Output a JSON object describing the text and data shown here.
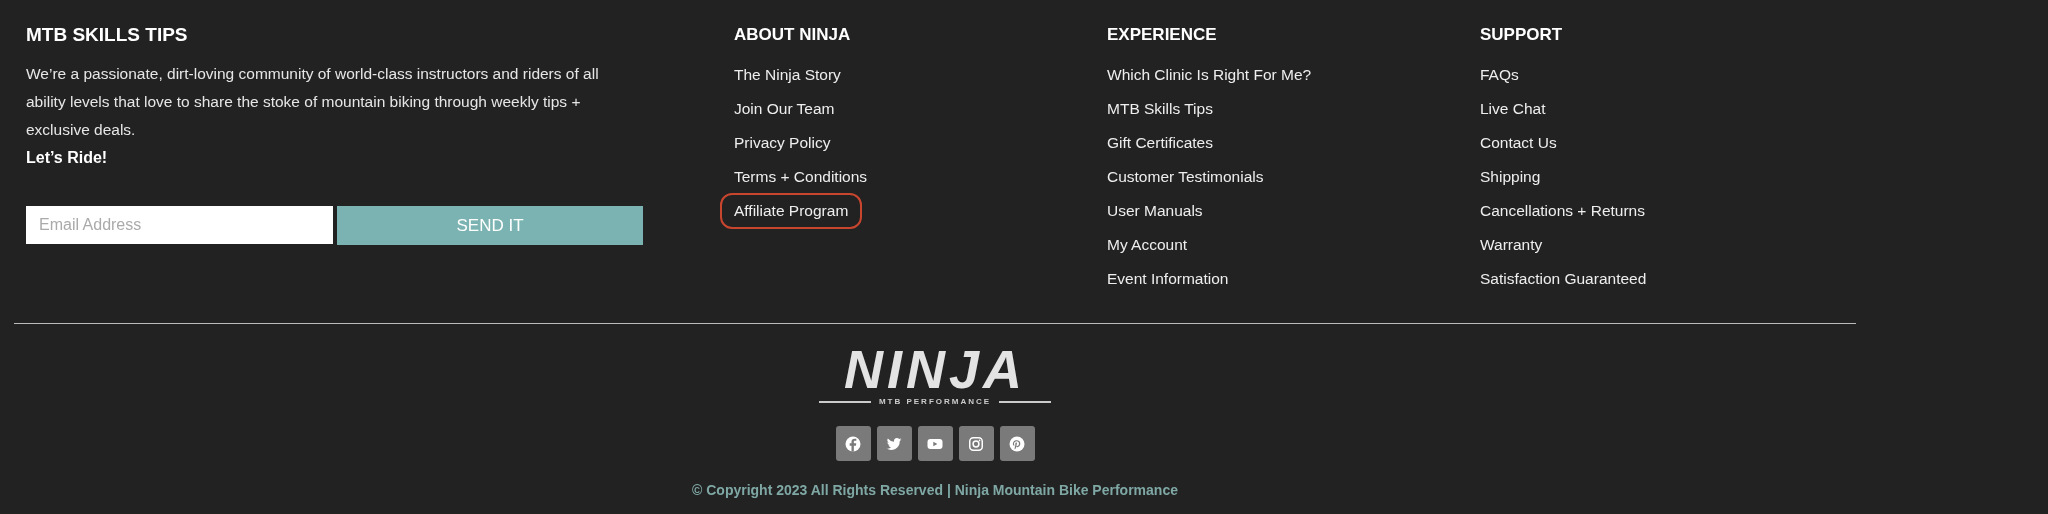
{
  "newsletter": {
    "heading": "MTB SKILLS TIPS",
    "text": "We’re a passionate, dirt-loving community of world-class instructors and riders of all ability levels that love to share the stoke of mountain biking through weekly tips + exclusive deals.",
    "tagline": "Let’s Ride!",
    "email_field": {
      "placeholder": "Email Address"
    },
    "button": "SEND IT"
  },
  "columns": [
    {
      "heading": "ABOUT NINJA",
      "links": [
        {
          "label": "The Ninja Story",
          "highlighted": false
        },
        {
          "label": "Join Our Team",
          "highlighted": false
        },
        {
          "label": "Privacy Policy",
          "highlighted": false
        },
        {
          "label": "Terms + Conditions",
          "highlighted": false
        },
        {
          "label": "Affiliate Program",
          "highlighted": true
        }
      ]
    },
    {
      "heading": "EXPERIENCE",
      "links": [
        {
          "label": "Which Clinic Is Right For Me?",
          "highlighted": false
        },
        {
          "label": "MTB Skills Tips",
          "highlighted": false
        },
        {
          "label": "Gift Certificates",
          "highlighted": false
        },
        {
          "label": "Customer Testimonials",
          "highlighted": false
        },
        {
          "label": "User Manuals",
          "highlighted": false
        },
        {
          "label": "My Account",
          "highlighted": false
        },
        {
          "label": "Event Information",
          "highlighted": false
        }
      ]
    },
    {
      "heading": "SUPPORT",
      "links": [
        {
          "label": "FAQs",
          "highlighted": false
        },
        {
          "label": "Live Chat",
          "highlighted": false
        },
        {
          "label": "Contact Us",
          "highlighted": false
        },
        {
          "label": "Shipping",
          "highlighted": false
        },
        {
          "label": "Cancellations + Returns",
          "highlighted": false
        },
        {
          "label": "Warranty",
          "highlighted": false
        },
        {
          "label": "Satisfaction Guaranteed",
          "highlighted": false
        }
      ]
    }
  ],
  "logo": {
    "name": "NINJA",
    "subtitle": "MTB PERFORMANCE"
  },
  "social": [
    {
      "kind": "facebook"
    },
    {
      "kind": "twitter"
    },
    {
      "kind": "youtube"
    },
    {
      "kind": "instagram"
    },
    {
      "kind": "pinterest"
    }
  ],
  "copyright": "© Copyright 2023 All Rights Reserved | Ninja Mountain Bike Performance"
}
